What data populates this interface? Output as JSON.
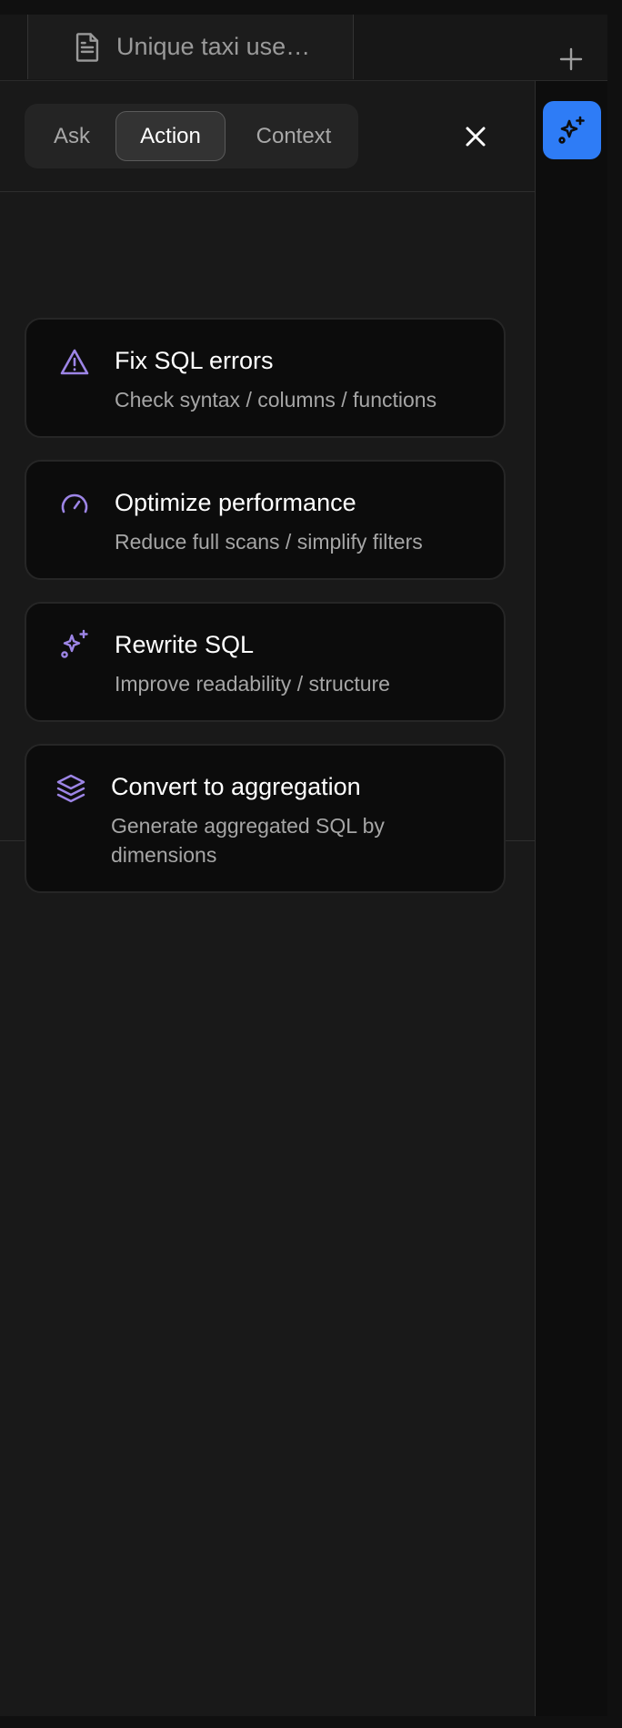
{
  "tab": {
    "title": "Unique taxi use…",
    "icon": "document-icon"
  },
  "panel": {
    "modes": [
      "Ask",
      "Action",
      "Context"
    ],
    "active_mode": "Action"
  },
  "actions": [
    {
      "icon": "warning-triangle-icon",
      "title": "Fix SQL errors",
      "description": "Check syntax / columns / functions"
    },
    {
      "icon": "gauge-icon",
      "title": "Optimize performance",
      "description": "Reduce full scans / simplify filters"
    },
    {
      "icon": "sparkles-icon",
      "title": "Rewrite SQL",
      "description": "Improve readability / structure"
    },
    {
      "icon": "layers-icon",
      "title": "Convert to aggregation",
      "description": "Generate aggregated SQL by dimensions"
    }
  ],
  "colors": {
    "accent_purple": "#9d85e6",
    "ai_button": "#2e7cf6"
  }
}
